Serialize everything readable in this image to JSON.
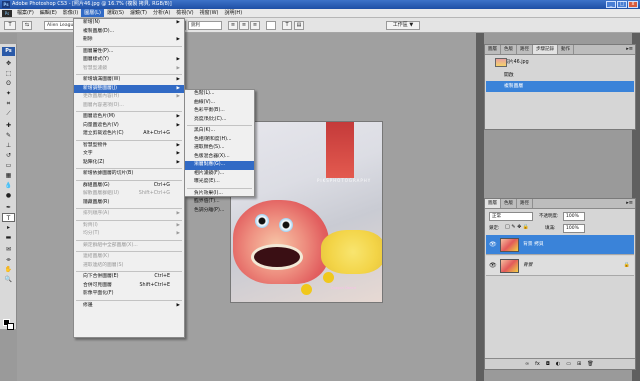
{
  "window": {
    "title": "Adobe Photoshop CS3 - [照片46.jpg @ 16.7% (複製 拷貝, RGB/8)]",
    "ps_badge": "Ps"
  },
  "menubar": [
    "檔案(F)",
    "編輯(E)",
    "影像(I)",
    "圖層(L)",
    "選取(S)",
    "濾鏡(T)",
    "分析(A)",
    "檢視(V)",
    "視窗(W)",
    "說明(H)"
  ],
  "menubar_active": 3,
  "options": {
    "tool_icon": "T",
    "font": "Alien League",
    "aa_label": "a",
    "aa_value": "銳利",
    "workspace": "工作區 ▼"
  },
  "layer_menu": {
    "items": [
      {
        "label": "新增(N)",
        "arrow": true
      },
      {
        "label": "複製圖層(D)..."
      },
      {
        "label": "刪除",
        "arrow": true
      },
      {
        "sep": true
      },
      {
        "label": "圖層屬性(P)..."
      },
      {
        "label": "圖層樣式(Y)",
        "arrow": true
      },
      {
        "label": "智慧型濾鏡",
        "arrow": true,
        "disabled": true
      },
      {
        "sep": true
      },
      {
        "label": "新增填滿圖層(W)",
        "arrow": true
      },
      {
        "label": "新增調整圖層(J)",
        "arrow": true,
        "highlight": true
      },
      {
        "label": "更改圖層內容(H)",
        "arrow": true,
        "disabled": true
      },
      {
        "label": "圖層內容選項(O)...",
        "disabled": true
      },
      {
        "sep": true
      },
      {
        "label": "圖層遮色片(M)",
        "arrow": true
      },
      {
        "label": "向量圖遮色片(V)",
        "arrow": true
      },
      {
        "label": "建立剪裁遮色片(C)",
        "shortcut": "Alt+Ctrl+G"
      },
      {
        "sep": true
      },
      {
        "label": "智慧型物件",
        "arrow": true
      },
      {
        "label": "文字",
        "arrow": true
      },
      {
        "label": "點陣化(Z)",
        "arrow": true
      },
      {
        "sep": true
      },
      {
        "label": "新增依據圖層的切片(B)"
      },
      {
        "sep": true
      },
      {
        "label": "群組圖層(G)",
        "shortcut": "Ctrl+G"
      },
      {
        "label": "解散圖層群組(U)",
        "shortcut": "Shift+Ctrl+G",
        "disabled": true
      },
      {
        "label": "隱藏圖層(R)"
      },
      {
        "sep": true
      },
      {
        "label": "排列順序(A)",
        "arrow": true,
        "disabled": true
      },
      {
        "sep": true
      },
      {
        "label": "對齊(I)",
        "arrow": true,
        "disabled": true
      },
      {
        "label": "均分(T)",
        "arrow": true,
        "disabled": true
      },
      {
        "sep": true
      },
      {
        "label": "鎖定群組中全部圖層(X)...",
        "disabled": true
      },
      {
        "sep": true
      },
      {
        "label": "連結圖層(K)",
        "disabled": true
      },
      {
        "label": "選取連結的圖層(S)",
        "disabled": true
      },
      {
        "sep": true
      },
      {
        "label": "向下合併圖層(E)",
        "shortcut": "Ctrl+E"
      },
      {
        "label": "合併可見圖層",
        "shortcut": "Shift+Ctrl+E"
      },
      {
        "label": "影像平面化(F)"
      },
      {
        "sep": true
      },
      {
        "label": "修邊",
        "arrow": true
      }
    ]
  },
  "adjust_submenu": {
    "items": [
      {
        "label": "色階(L)..."
      },
      {
        "label": "曲線(V)..."
      },
      {
        "label": "色彩平衡(B)..."
      },
      {
        "label": "亮度/對比(C)..."
      },
      {
        "sep": true
      },
      {
        "label": "黑白(K)..."
      },
      {
        "label": "色相/飽和度(H)..."
      },
      {
        "label": "選取顏色(S)..."
      },
      {
        "label": "色版混合器(X)..."
      },
      {
        "label": "漸層對應(G)...",
        "highlight": true
      },
      {
        "label": "相片濾鏡(F)..."
      },
      {
        "label": "曝光度(E)..."
      },
      {
        "sep": true
      },
      {
        "label": "負片效果(I)..."
      },
      {
        "label": "臨界值(T)..."
      },
      {
        "label": "色調分離(P)..."
      }
    ]
  },
  "photo_watermark": "PIKSPHOTOGRAPHY",
  "photo_watermark2": "Dragon Dance",
  "history_panel": {
    "tabs": [
      "圖層",
      "色版",
      "路徑",
      "步驟記錄",
      "動作"
    ],
    "active_tab": 3,
    "snapshot": "照片46.jpg",
    "steps": [
      "開啟",
      "複製圖層"
    ],
    "selected_step": 1
  },
  "layers_panel": {
    "tabs": [
      "圖層",
      "色版",
      "路徑"
    ],
    "blend_mode": "正常",
    "opacity_label": "不透明度:",
    "opacity": "100%",
    "lock_label": "鎖定:",
    "fill_label": "填滿:",
    "fill": "100%",
    "layers": [
      {
        "name": "背景 拷貝",
        "selected": true,
        "italic": false
      },
      {
        "name": "背景",
        "selected": false,
        "italic": true
      }
    ],
    "footer_icons": [
      "link-icon",
      "fx-icon",
      "mask-icon",
      "adjust-icon",
      "folder-icon",
      "new-icon",
      "trash-icon"
    ]
  }
}
